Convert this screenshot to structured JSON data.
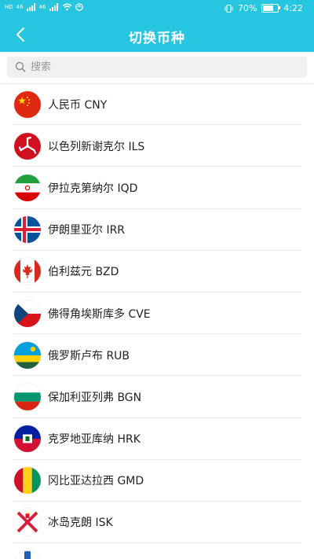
{
  "status_bar": {
    "left_chips": [
      "HD",
      "46",
      "46"
    ],
    "battery_percent": "70%",
    "battery_level": 0.7,
    "time": "4:22"
  },
  "header": {
    "title": "切换币种",
    "background_color": "#27c6e0"
  },
  "search": {
    "placeholder": "搜索",
    "value": ""
  },
  "currencies": [
    {
      "label": "人民币 CNY",
      "flag": "china-flag-icon"
    },
    {
      "label": "以色列新谢克尔 ILS",
      "flag": "isle-of-man-flag-icon"
    },
    {
      "label": "伊拉克第纳尔 IQD",
      "flag": "iran-flag-icon"
    },
    {
      "label": "伊朗里亚尔 IRR",
      "flag": "iceland-flag-icon"
    },
    {
      "label": "伯利兹元 BZD",
      "flag": "canada-flag-icon"
    },
    {
      "label": "佛得角埃斯库多 CVE",
      "flag": "czech-flag-icon"
    },
    {
      "label": "俄罗斯卢布 RUB",
      "flag": "rwanda-flag-icon"
    },
    {
      "label": "保加利亚列弗 BGN",
      "flag": "bulgaria-flag-icon"
    },
    {
      "label": "克罗地亚库纳 HRK",
      "flag": "haiti-flag-icon"
    },
    {
      "label": "冈比亚达拉西 GMD",
      "flag": "guinea-flag-icon"
    },
    {
      "label": "冰岛克朗 ISK",
      "flag": "jersey-flag-icon"
    }
  ]
}
